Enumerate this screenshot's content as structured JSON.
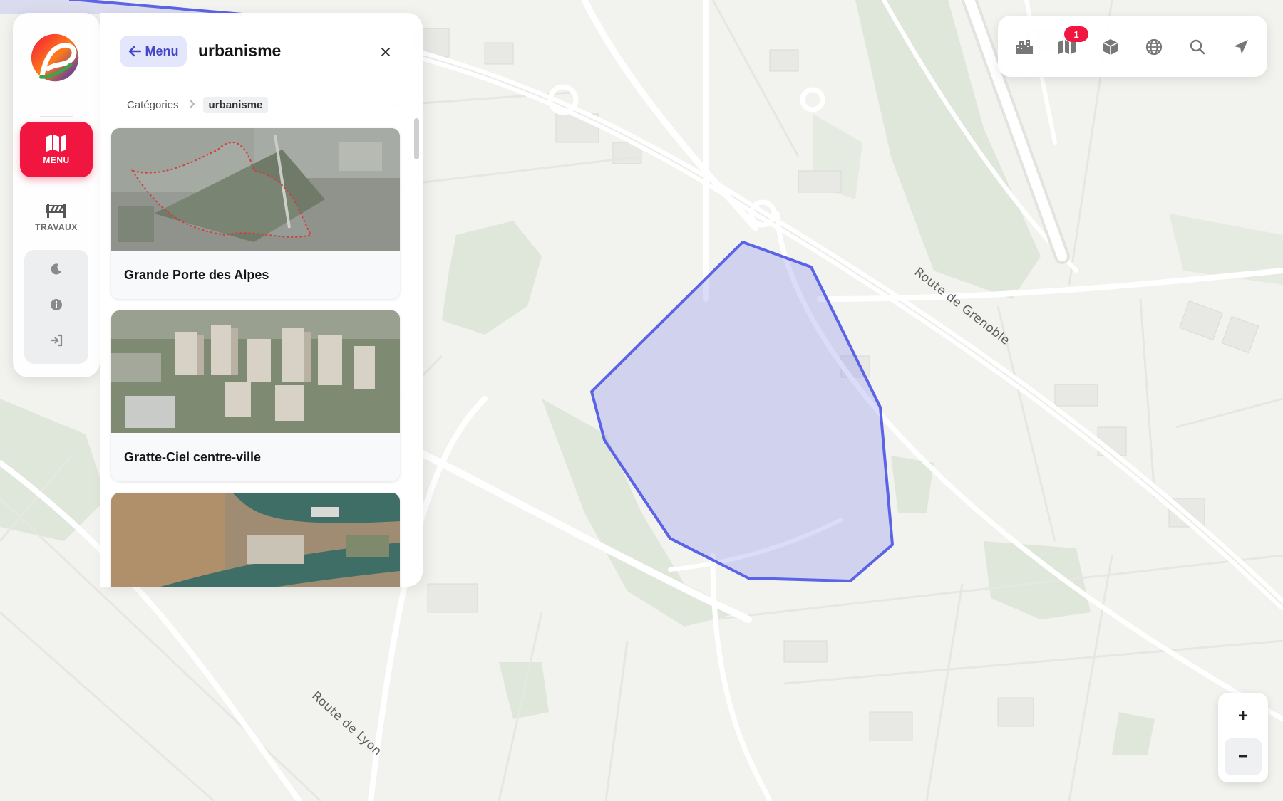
{
  "map": {
    "labels": {
      "route_grenoble": "Route de Grenoble",
      "route_lyon": "Route de Lyon"
    },
    "highlight_color": "#5b63e6"
  },
  "sidebar": {
    "menu_label": "MENU",
    "works_label": "TRAVAUX",
    "accent_color": "#f0163f"
  },
  "panel": {
    "back_label": "Menu",
    "title": "urbanisme",
    "breadcrumb": {
      "root": "Catégories",
      "current": "urbanisme"
    },
    "cards": [
      {
        "title": "Grande Porte des Alpes"
      },
      {
        "title": "Gratte-Ciel centre-ville"
      },
      {
        "title": ""
      }
    ]
  },
  "toolbar": {
    "icons": [
      "city-icon",
      "map-icon",
      "cube-icon",
      "globe-icon",
      "search-icon",
      "locate-icon"
    ],
    "map_badge": "1"
  },
  "zoom": {
    "in_label": "+",
    "out_label": "−"
  }
}
